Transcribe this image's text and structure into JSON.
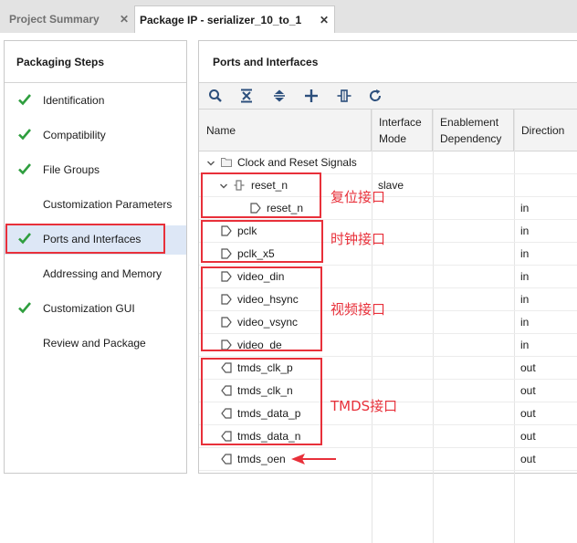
{
  "tabs": [
    {
      "label": "Project Summary",
      "close": "✕"
    },
    {
      "label": "Package IP - serializer_10_to_1",
      "close": "✕"
    }
  ],
  "steps_title": "Packaging Steps",
  "steps": [
    {
      "label": "Identification",
      "done": true
    },
    {
      "label": "Compatibility",
      "done": true
    },
    {
      "label": "File Groups",
      "done": true
    },
    {
      "label": "Customization Parameters",
      "done": false
    },
    {
      "label": "Ports and Interfaces",
      "done": true,
      "active": true
    },
    {
      "label": "Addressing and Memory",
      "done": false
    },
    {
      "label": "Customization GUI",
      "done": true
    },
    {
      "label": "Review and Package",
      "done": false
    }
  ],
  "panel_title": "Ports and Interfaces",
  "toolbar": [
    "search-icon",
    "collapse-all-icon",
    "expand-all-icon",
    "add-icon",
    "map-icon",
    "refresh-icon"
  ],
  "columns": {
    "name": "Name",
    "interface_mode": "Interface Mode",
    "enablement_dependency": "Enablement Dependency",
    "direction": "Direction"
  },
  "rows": [
    {
      "name": "Clock and Reset Signals",
      "mode": "",
      "direction": "",
      "kind": "group"
    },
    {
      "name": "reset_n",
      "mode": "slave",
      "direction": "",
      "kind": "interface"
    },
    {
      "name": "reset_n",
      "mode": "",
      "direction": "in",
      "kind": "port-in-nested"
    },
    {
      "name": "pclk",
      "mode": "",
      "direction": "in",
      "kind": "port-in"
    },
    {
      "name": "pclk_x5",
      "mode": "",
      "direction": "in",
      "kind": "port-in"
    },
    {
      "name": "video_din",
      "mode": "",
      "direction": "in",
      "kind": "port-in"
    },
    {
      "name": "video_hsync",
      "mode": "",
      "direction": "in",
      "kind": "port-in"
    },
    {
      "name": "video_vsync",
      "mode": "",
      "direction": "in",
      "kind": "port-in"
    },
    {
      "name": "video_de",
      "mode": "",
      "direction": "in",
      "kind": "port-in"
    },
    {
      "name": "tmds_clk_p",
      "mode": "",
      "direction": "out",
      "kind": "port-out"
    },
    {
      "name": "tmds_clk_n",
      "mode": "",
      "direction": "out",
      "kind": "port-out"
    },
    {
      "name": "tmds_data_p",
      "mode": "",
      "direction": "out",
      "kind": "port-out"
    },
    {
      "name": "tmds_data_n",
      "mode": "",
      "direction": "out",
      "kind": "port-out"
    },
    {
      "name": "tmds_oen",
      "mode": "",
      "direction": "out",
      "kind": "port-out"
    }
  ],
  "annotations": {
    "reset": "复位接口",
    "clock": "时钟接口",
    "video": "视频接口",
    "tmds": "TMDS接口"
  },
  "colors": {
    "annotation": "#e8303a",
    "check": "#2e9e3e",
    "active_row": "#dde7f6"
  }
}
